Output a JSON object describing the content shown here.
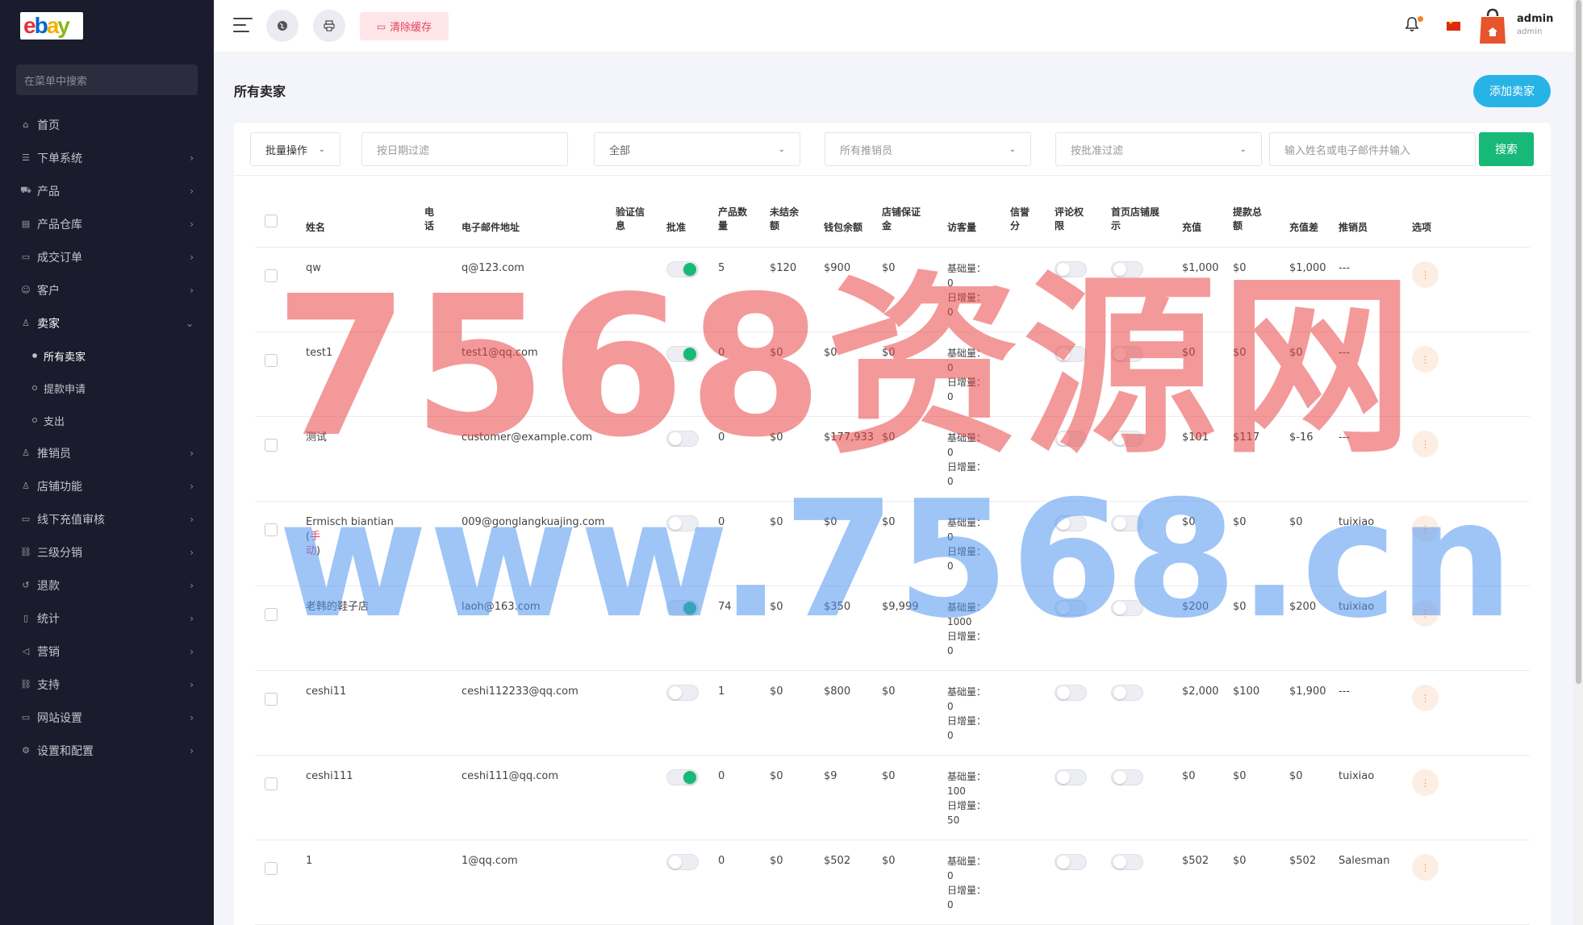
{
  "sidebar": {
    "logo": [
      "e",
      "b",
      "a",
      "y"
    ],
    "search_placeholder": "在菜单中搜索",
    "items": [
      {
        "label": "首页",
        "icon": "home-icon",
        "glyph": "⌂",
        "has_children": false
      },
      {
        "label": "下单系统",
        "icon": "list-icon",
        "glyph": "☰",
        "has_children": true
      },
      {
        "label": "产品",
        "icon": "cart-icon",
        "glyph": "⛟",
        "has_children": true
      },
      {
        "label": "产品仓库",
        "icon": "warehouse-icon",
        "glyph": "▤",
        "has_children": true
      },
      {
        "label": "成交订单",
        "icon": "order-icon",
        "glyph": "▭",
        "has_children": true
      },
      {
        "label": "客户",
        "icon": "users-icon",
        "glyph": "☺",
        "has_children": true
      },
      {
        "label": "卖家",
        "icon": "user-icon",
        "glyph": "♙",
        "has_children": true,
        "expanded": true
      }
    ],
    "sub_items": [
      {
        "label": "所有卖家",
        "active": true
      },
      {
        "label": "提款申请",
        "active": false
      },
      {
        "label": "支出",
        "active": false
      }
    ],
    "items_after": [
      {
        "label": "推销员",
        "icon": "user-icon",
        "glyph": "♙"
      },
      {
        "label": "店铺功能",
        "icon": "user-icon",
        "glyph": "♙"
      },
      {
        "label": "线下充值审核",
        "icon": "card-icon",
        "glyph": "▭"
      },
      {
        "label": "三级分销",
        "icon": "link-icon",
        "glyph": "⛓"
      },
      {
        "label": "退款",
        "icon": "refund-icon",
        "glyph": "↺"
      },
      {
        "label": "统计",
        "icon": "file-icon",
        "glyph": "▯"
      },
      {
        "label": "营销",
        "icon": "megaphone-icon",
        "glyph": "◁"
      },
      {
        "label": "支持",
        "icon": "link-icon",
        "glyph": "⛓"
      },
      {
        "label": "网站设置",
        "icon": "monitor-icon",
        "glyph": "▭"
      },
      {
        "label": "设置和配置",
        "icon": "gear-icon",
        "glyph": "⚙"
      }
    ]
  },
  "topbar": {
    "clear_cache_label": "清除缓存",
    "user_name": "admin",
    "user_role": "admin"
  },
  "page": {
    "title": "所有卖家",
    "add_button": "添加卖家"
  },
  "filters": {
    "bulk_action": "批量操作",
    "date_placeholder": "按日期过滤",
    "status_select": "全部",
    "salesman_select": "所有推销员",
    "approval_select": "按批准过滤",
    "keyword_placeholder": "输入姓名或电子邮件并输入",
    "search_button": "搜索"
  },
  "table": {
    "headers": [
      "姓名",
      "电话",
      "电子邮件地址",
      "验证信息",
      "批准",
      "产品数量",
      "未结余额",
      "钱包余额",
      "店铺保证金",
      "访客量",
      "信誉分",
      "评论权限",
      "首页店铺展示",
      "充值",
      "提款总额",
      "充值差",
      "推销员",
      "选项"
    ],
    "rows": [
      {
        "name": "qw",
        "name_suffix": "",
        "email": "q@123.com",
        "approved": true,
        "products": "5",
        "unsettled": "$120",
        "wallet": "$900",
        "deposit": "$0",
        "base": "基础量：",
        "base_val": "0",
        "daily": "日增量：",
        "daily_val": "0",
        "recharge": "$1,000",
        "withdraw": "$0",
        "diff": "$1,000",
        "salesman": "---"
      },
      {
        "name": "test1",
        "name_suffix": "",
        "email": "test1@qq.com",
        "approved": true,
        "products": "0",
        "unsettled": "$0",
        "wallet": "$0",
        "deposit": "$0",
        "base": "基础量：",
        "base_val": "0",
        "daily": "日增量：",
        "daily_val": "0",
        "recharge": "$0",
        "withdraw": "$0",
        "diff": "$0",
        "salesman": "---"
      },
      {
        "name": "测试",
        "name_suffix": "",
        "email": "customer@example.com",
        "approved": false,
        "products": "0",
        "unsettled": "$0",
        "wallet": "$177,933",
        "deposit": "$0",
        "base": "基础量：",
        "base_val": "0",
        "daily": "日增量：",
        "daily_val": "0",
        "recharge": "$101",
        "withdraw": "$117",
        "diff": "$-16",
        "salesman": "---"
      },
      {
        "name": "Ermisch biantian (",
        "name_suffix": "手",
        "name_line2": "动",
        "name_close": ")",
        "email": "009@gonglangkuajing.com",
        "approved": false,
        "products": "0",
        "unsettled": "$0",
        "wallet": "$0",
        "deposit": "$0",
        "base": "基础量：",
        "base_val": "0",
        "daily": "日增量：",
        "daily_val": "0",
        "recharge": "$0",
        "withdraw": "$0",
        "diff": "$0",
        "salesman": "tuixiao"
      },
      {
        "name": "老韩的鞋子店",
        "name_suffix": "",
        "email": "laoh@163.com",
        "approved": true,
        "products": "74",
        "unsettled": "$0",
        "wallet": "$350",
        "deposit": "$9,999",
        "base": "基础量：",
        "base_val": "1000",
        "daily": "日增量：",
        "daily_val": "0",
        "recharge": "$200",
        "withdraw": "$0",
        "diff": "$200",
        "salesman": "tuixiao"
      },
      {
        "name": "ceshi11",
        "name_suffix": "",
        "email": "ceshi112233@qq.com",
        "approved": false,
        "products": "1",
        "unsettled": "$0",
        "wallet": "$800",
        "deposit": "$0",
        "base": "基础量：",
        "base_val": "0",
        "daily": "日增量：",
        "daily_val": "0",
        "recharge": "$2,000",
        "withdraw": "$100",
        "diff": "$1,900",
        "salesman": "---"
      },
      {
        "name": "ceshi111",
        "name_suffix": "",
        "email": "ceshi111@qq.com",
        "approved": true,
        "products": "0",
        "unsettled": "$0",
        "wallet": "$9",
        "deposit": "$0",
        "base": "基础量：",
        "base_val": "100",
        "daily": "日增量：",
        "daily_val": "50",
        "recharge": "$0",
        "withdraw": "$0",
        "diff": "$0",
        "salesman": "tuixiao"
      },
      {
        "name": "1",
        "name_suffix": "",
        "email": "1@qq.com",
        "approved": false,
        "products": "0",
        "unsettled": "$0",
        "wallet": "$502",
        "deposit": "$0",
        "base": "基础量：",
        "base_val": "0",
        "daily": "日增量：",
        "daily_val": "0",
        "recharge": "$502",
        "withdraw": "$0",
        "diff": "$502",
        "salesman": "Salesman"
      }
    ]
  },
  "watermark": {
    "line1": "7568资源网",
    "line2": "www.7568.cn"
  },
  "colors": {
    "sidebar_bg": "#1a1c2d",
    "accent_green": "#17b978",
    "accent_blue": "#28b3e7",
    "clear_cache_red": "#e2445c"
  }
}
